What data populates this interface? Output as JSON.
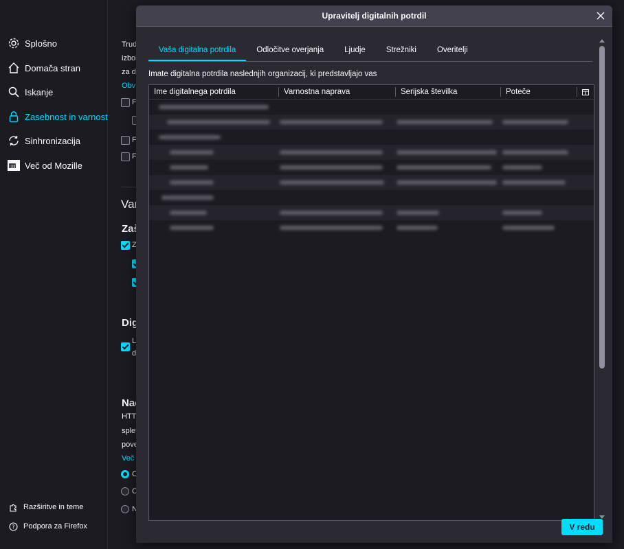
{
  "sidebar": {
    "items": [
      {
        "label": "Splošno",
        "icon": "gear-icon"
      },
      {
        "label": "Domača stran",
        "icon": "home-icon"
      },
      {
        "label": "Iskanje",
        "icon": "search-icon"
      },
      {
        "label": "Zasebnost in varnost",
        "icon": "lock-icon",
        "active": true
      },
      {
        "label": "Sinhronizacija",
        "icon": "sync-icon"
      },
      {
        "label": "Več od Mozille",
        "icon": "mozilla-icon"
      }
    ],
    "footer": [
      {
        "label": "Razširitve in teme",
        "icon": "puzzle-icon"
      },
      {
        "label": "Podpora za Firefox",
        "icon": "help-icon"
      }
    ]
  },
  "background": {
    "frag1": "Trud",
    "frag2": "izbol",
    "frag3": "za d",
    "link1": "Obv",
    "frag4": "F",
    "frag5": "F",
    "frag6": "F",
    "heading1": "Var",
    "heading2": "Zaš",
    "frag7": "Z",
    "heading3": "Dig",
    "frag8": "L",
    "frag9": "d",
    "heading4": "Nač",
    "frag10": "HTT",
    "frag11": "splet",
    "frag12": "pove",
    "link2": "Več",
    "frag13": "C",
    "frag14": "C",
    "frag15": "N"
  },
  "dialog": {
    "title": "Upravitelj digitalnih potrdil",
    "tabs": [
      "Vaša digitalna potrdila",
      "Odločitve overjanja",
      "Ljudje",
      "Strežniki",
      "Overitelji"
    ],
    "info": "Imate digitalna potrdila naslednjih organizacij, ki predstavljajo vas",
    "columns": [
      "Ime digitalnega potrdila",
      "Varnostna naprava",
      "Serijska številka",
      "Poteče"
    ],
    "ok_label": "V redu"
  }
}
